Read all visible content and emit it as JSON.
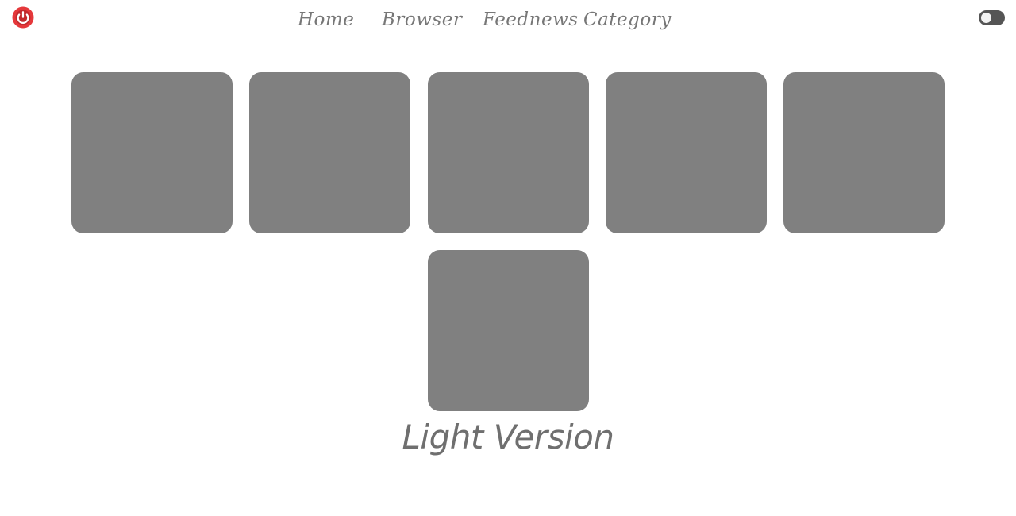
{
  "header": {
    "power_icon": "power-icon",
    "power_color": "#e5383b",
    "nav": [
      {
        "label": "Home"
      },
      {
        "label": "Browser"
      },
      {
        "label": "Feednews"
      },
      {
        "label": "Category"
      }
    ],
    "theme_toggle": {
      "state": "off"
    }
  },
  "tiles": [
    {
      "color": "#808080"
    },
    {
      "color": "#808080"
    },
    {
      "color": "#808080"
    },
    {
      "color": "#808080"
    },
    {
      "color": "#808080"
    },
    {
      "color": "#808080"
    }
  ],
  "footer": {
    "version_label": "Light Version"
  }
}
